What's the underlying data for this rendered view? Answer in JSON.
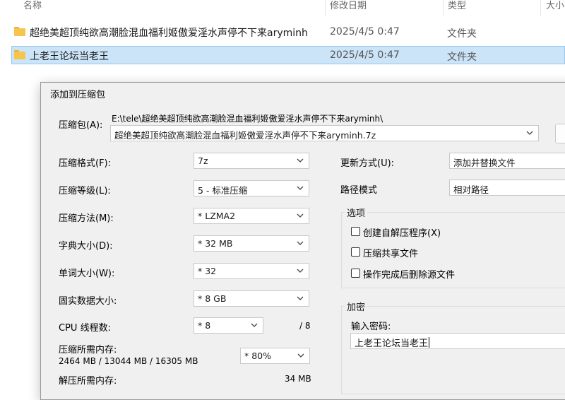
{
  "explorer": {
    "columns": [
      "名称",
      "修改日期",
      "类型",
      "大小"
    ],
    "rows": [
      {
        "name": "超绝美超顶纯欲高潮脸混血福利姬傲爱淫水声停不下来aryminh",
        "date": "2025/4/5 0:47",
        "type": "文件夹",
        "selected": false
      },
      {
        "name": "上老王论坛当老王",
        "date": "2025/4/5 0:47",
        "type": "文件夹",
        "selected": true
      }
    ]
  },
  "dialog": {
    "title": "添加到压缩包",
    "archive_label": "压缩包(A):",
    "archive_path": "E:\\tele\\超绝美超顶纯欲高潮脸混血福利姬傲爱淫水声停不下来aryminh\\",
    "archive_name": "超绝美超顶纯欲高潮脸混血福利姬傲爱淫水声停不下来aryminh.7z",
    "format_label": "压缩格式(F):",
    "format_value": "7z",
    "level_label": "压缩等级(L):",
    "level_value": "5 - 标准压缩",
    "method_label": "压缩方法(M):",
    "method_value": "*  LZMA2",
    "dict_label": "字典大小(D):",
    "dict_value": "*  32 MB",
    "word_label": "单词大小(W):",
    "word_value": "*  32",
    "solid_label": "固实数据大小:",
    "solid_value": "*  8 GB",
    "cpu_label": "CPU 线程数:",
    "cpu_value": "*  8",
    "cpu_total": "/ 8",
    "mem_comp_label": "压缩所需内存:",
    "mem_comp_detail": "2464 MB / 13044 MB / 16305 MB",
    "mem_percent": "*  80%",
    "mem_decomp_label": "解压所需内存:",
    "mem_decomp_value": "34 MB",
    "update_label": "更新方式(U):",
    "update_value": "添加并替换文件",
    "path_label": "路径模式",
    "path_value": "相对路径",
    "options_title": "选项",
    "options": [
      {
        "label": "创建自解压程序(X)",
        "checked": false
      },
      {
        "label": "压缩共享文件",
        "checked": false
      },
      {
        "label": "操作完成后删除源文件",
        "checked": false
      }
    ],
    "encrypt_title": "加密",
    "password_label": "输入密码:",
    "password_value": "上老王论坛当老王"
  }
}
